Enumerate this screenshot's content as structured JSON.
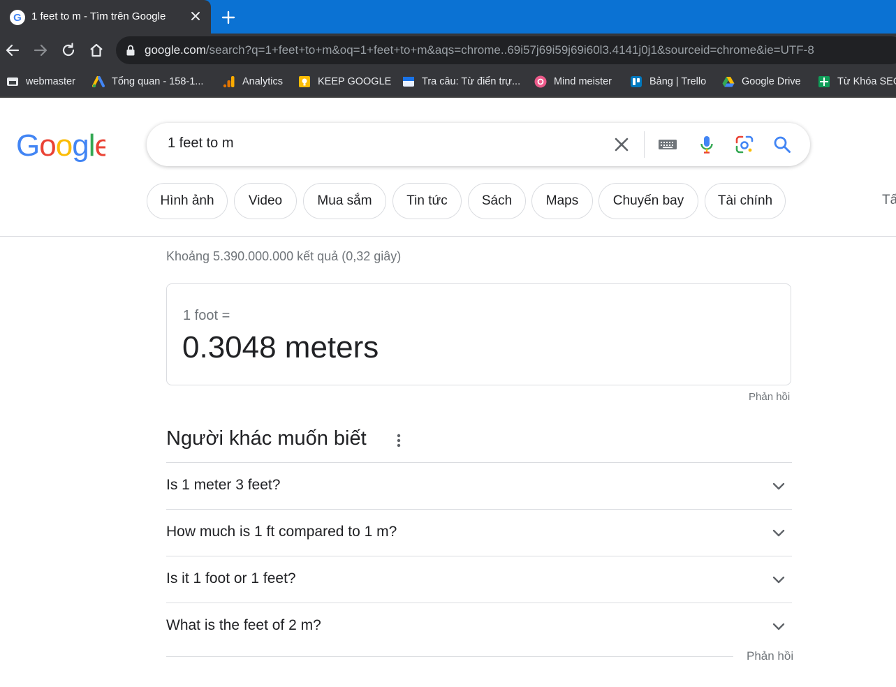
{
  "browser": {
    "tab_title": "1 feet to m - Tìm trên Google",
    "url_host": "google.com",
    "url_path": "/search?q=1+feet+to+m&oq=1+feet+to+m&aqs=chrome..69i57j69i59j69i60l3.4141j0j1&sourceid=chrome&ie=UTF-8",
    "bookmarks": [
      {
        "label": "webmaster",
        "icon": "webmaster-icon"
      },
      {
        "label": "Tổng quan - 158-1...",
        "icon": "google-ads-icon"
      },
      {
        "label": "Analytics",
        "icon": "analytics-icon"
      },
      {
        "label": "KEEP GOOGLE",
        "icon": "keep-icon"
      },
      {
        "label": "Tra câu: Từ điển trự...",
        "icon": "dictionary-icon"
      },
      {
        "label": "Mind meister",
        "icon": "mindmeister-icon"
      },
      {
        "label": "Bảng | Trello",
        "icon": "trello-icon"
      },
      {
        "label": "Google Drive",
        "icon": "drive-icon"
      },
      {
        "label": "Từ Khóa SEO",
        "icon": "sheets-icon"
      }
    ],
    "colors": {
      "tabbar": "#0b72d3",
      "toolbar": "#35363a"
    }
  },
  "search": {
    "query": "1 feet to m",
    "chips": [
      "Hình ảnh",
      "Video",
      "Mua sắm",
      "Tin tức",
      "Sách",
      "Maps",
      "Chuyến bay",
      "Tài chính"
    ],
    "chip_more": "Tấ",
    "stats": "Khoảng 5.390.000.000 kết quả (0,32 giây)"
  },
  "converter": {
    "from": "1 foot =",
    "to": "0.3048 meters",
    "feedback": "Phản hồi"
  },
  "paa": {
    "title": "Người khác muốn biết",
    "questions": [
      "Is 1 meter 3 feet?",
      "How much is 1 ft compared to 1 m?",
      "Is it 1 foot or 1 feet?",
      "What is the feet of 2 m?"
    ],
    "feedback": "Phản hồi"
  }
}
